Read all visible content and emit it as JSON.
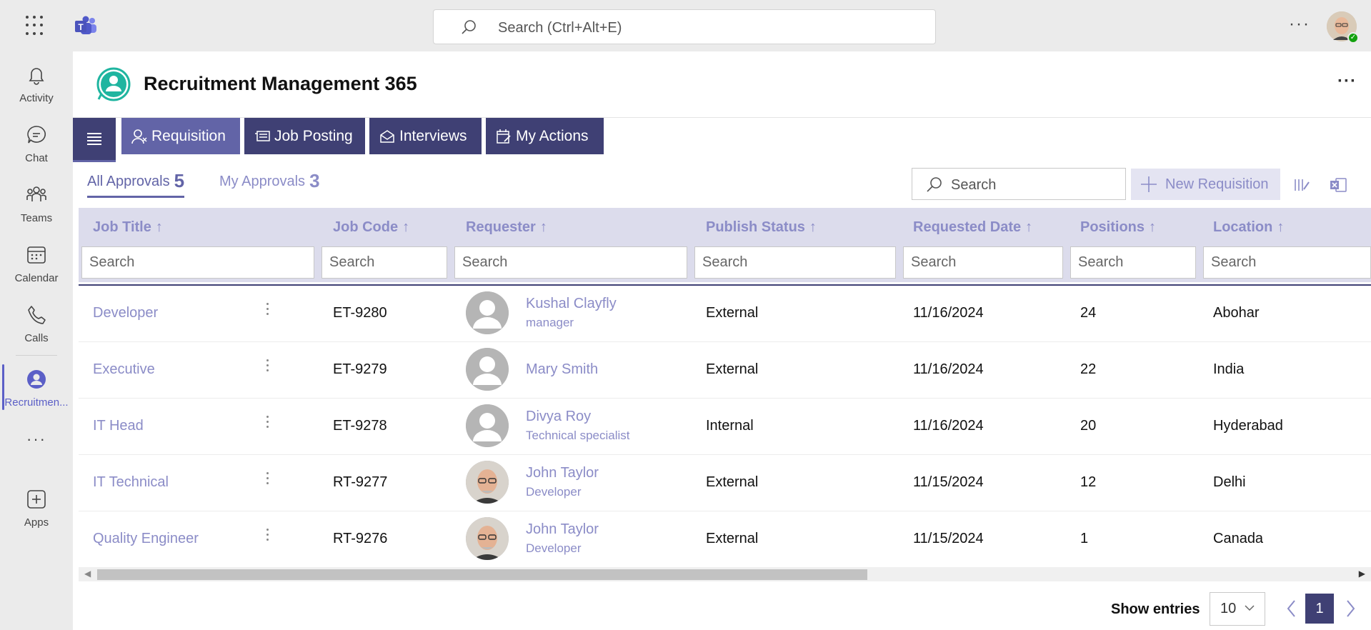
{
  "topbar": {
    "search_placeholder": "Search (Ctrl+Alt+E)",
    "more_label": "···"
  },
  "rail": {
    "items": [
      {
        "label": "Activity",
        "icon": "bell-icon"
      },
      {
        "label": "Chat",
        "icon": "chat-icon"
      },
      {
        "label": "Teams",
        "icon": "teams-icon"
      },
      {
        "label": "Calendar",
        "icon": "calendar-icon"
      },
      {
        "label": "Calls",
        "icon": "phone-icon"
      },
      {
        "label": "Recruitmen...",
        "icon": "recruitment-icon"
      },
      {
        "label": "Apps",
        "icon": "add-app-icon"
      }
    ],
    "more_label": "···"
  },
  "app": {
    "title": "Recruitment Management 365",
    "more_label": "···"
  },
  "nav": {
    "tabs": [
      {
        "label": "Requisition",
        "active": true
      },
      {
        "label": "Job Posting",
        "active": false
      },
      {
        "label": "Interviews",
        "active": false
      },
      {
        "label": "My Actions",
        "active": false
      }
    ]
  },
  "approvals": {
    "all_label": "All Approvals",
    "all_count": "5",
    "my_label": "My Approvals",
    "my_count": "3"
  },
  "toolbar": {
    "search_placeholder": "Search",
    "new_requisition_label": "New Requisition"
  },
  "table": {
    "headers": [
      "Job Title",
      "Job Code",
      "Requester",
      "Publish Status",
      "Requested Date",
      "Positions",
      "Location"
    ],
    "sort_arrow": "↑",
    "filter_placeholder": "Search",
    "rows": [
      {
        "title": "Developer",
        "code": "ET-9280",
        "requester": "Kushal Clayfly",
        "role": "manager",
        "photo": false,
        "status": "External",
        "date": "11/16/2024",
        "positions": "24",
        "location": "Abohar"
      },
      {
        "title": "Executive",
        "code": "ET-9279",
        "requester": "Mary Smith",
        "role": "",
        "photo": false,
        "status": "External",
        "date": "11/16/2024",
        "positions": "22",
        "location": "India"
      },
      {
        "title": "IT Head",
        "code": "ET-9278",
        "requester": "Divya Roy",
        "role": "Technical specialist",
        "photo": false,
        "status": "Internal",
        "date": "11/16/2024",
        "positions": "20",
        "location": "Hyderabad"
      },
      {
        "title": "IT Technical",
        "code": "RT-9277",
        "requester": "John Taylor",
        "role": "Developer",
        "photo": true,
        "status": "External",
        "date": "11/15/2024",
        "positions": "12",
        "location": "Delhi"
      },
      {
        "title": "Quality Engineer",
        "code": "RT-9276",
        "requester": "John Taylor",
        "role": "Developer",
        "photo": true,
        "status": "External",
        "date": "11/15/2024",
        "positions": "1",
        "location": "Canada"
      }
    ]
  },
  "pagination": {
    "show_entries_label": "Show entries",
    "page_size": "10",
    "current_page": "1"
  },
  "colors": {
    "accent": "#6264a7",
    "nav_dark": "#3f4074",
    "link": "#8b8cc7",
    "header_bg": "#dcdcec"
  }
}
